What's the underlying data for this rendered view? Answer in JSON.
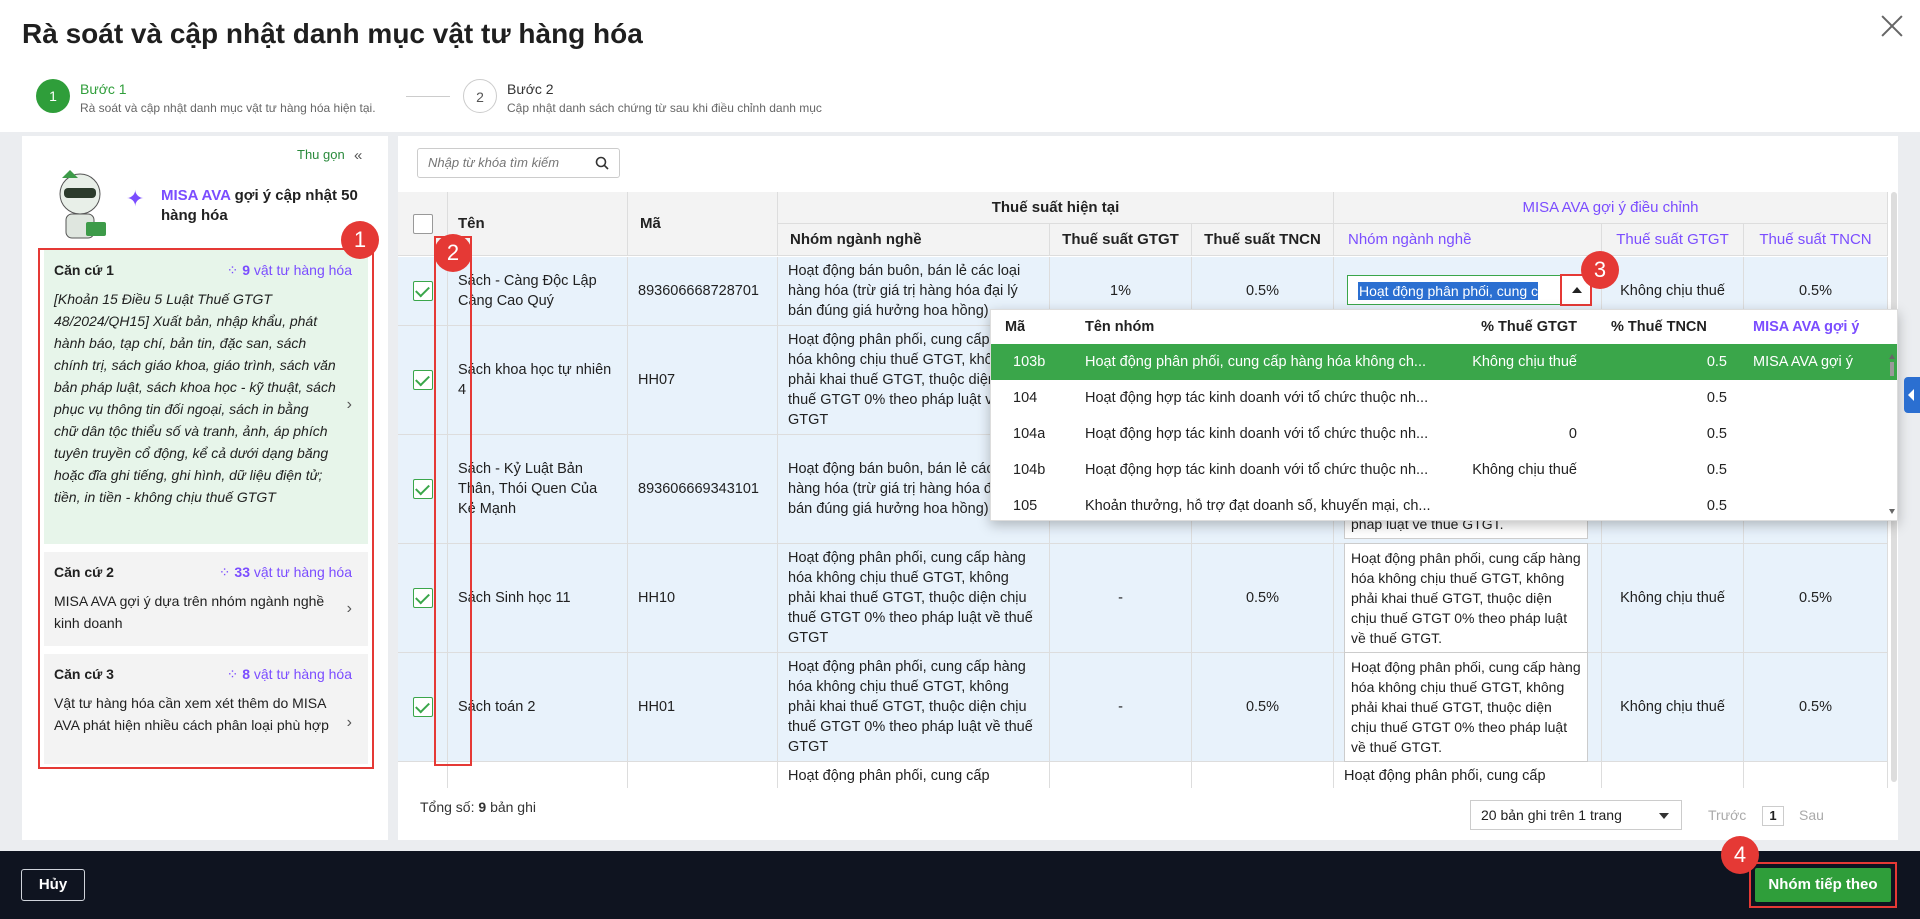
{
  "title": "Rà soát và cập nhật danh mục vật tư hàng hóa",
  "steps": [
    {
      "num": "1",
      "label": "Bước 1",
      "desc": "Rà soát và cập nhật danh mục vật tư hàng hóa hiện tại."
    },
    {
      "num": "2",
      "label": "Bước 2",
      "desc": "Cập nhật danh sách chứng từ sau khi điều chỉnh danh mục"
    }
  ],
  "sidebar": {
    "collapse_label": "Thu gọn",
    "ava_name": "MISA AVA",
    "ava_text": "gợi ý cập nhật 50 hàng hóa",
    "cards": [
      {
        "title": "Căn cứ 1",
        "count": "9",
        "count_suffix": "vật tư hàng hóa",
        "body": "[Khoản 15 Điều 5 Luật Thuế GTGT 48/2024/QH15] Xuất bản, nhập khẩu, phát hành báo, tạp chí, bản tin, đặc san, sách chính trị, sách giáo khoa, giáo trình, sách văn bản pháp luật, sách khoa học - kỹ thuật, sách phục vụ thông tin đối ngoại, sách in bằng chữ dân tộc thiểu số và tranh, ảnh, áp phích tuyên truyền cổ động, kể cả dưới dạng băng hoặc đĩa ghi tiếng, ghi hình, dữ liệu điện tử; tiền, in tiền - không chịu thuế GTGT"
      },
      {
        "title": "Căn cứ 2",
        "count": "33",
        "count_suffix": "vật tư hàng hóa",
        "body": "MISA AVA gợi ý dựa trên nhóm ngành nghề kinh doanh"
      },
      {
        "title": "Căn cứ 3",
        "count": "8",
        "count_suffix": "vật tư hàng hóa",
        "body": "Vật tư hàng hóa cần xem xét thêm do MISA AVA phát hiện nhiều cách phân loại phù hợp"
      }
    ]
  },
  "search": {
    "placeholder": "Nhập từ khóa tìm kiếm"
  },
  "table": {
    "headers": {
      "name": "Tên",
      "code": "Mã",
      "current_group": "Thuế suất hiện tại",
      "ava_group": "MISA AVA gợi ý điều chỉnh",
      "industry": "Nhóm ngành nghề",
      "vat": "Thuế suất GTGT",
      "pit": "Thuế suất TNCN"
    },
    "rows": [
      {
        "name": "Sách - Càng Độc Lập Càng Cao Quý",
        "code": "893606668728701",
        "industry": "Hoạt động bán buôn, bán lẻ các loại hàng hóa (trừ giá trị hàng hóa đại lý bán đúng giá hưởng hoa hồng)",
        "vat": "1%",
        "pit": "0.5%",
        "ava_industry": "Hoạt động phân phối, cung cấp hàng hóa không chịu thuế GTGT",
        "ava_vat": "Không chịu thuế",
        "ava_pit": "0.5%"
      },
      {
        "name": "Sách khoa học tự nhiên 4",
        "code": "HH07",
        "industry": "Hoạt động phân phối, cung cấp hàng hóa không chịu thuế GTGT, không phải khai thuế GTGT, thuộc diện chịu thuế GTGT 0% theo pháp luật về thuế GTGT",
        "vat": "",
        "pit": "",
        "ava_industry": "",
        "ava_vat": "",
        "ava_pit": ""
      },
      {
        "name": "Sách - Kỷ Luật Bản Thân, Thói Quen Của Kẻ Mạnh",
        "code": "893606669343101",
        "industry": "Hoạt động bán buôn, bán lẻ các loại hàng hóa (trừ giá trị hàng hóa đại lý bán đúng giá hưởng hoa hồng)",
        "vat": "",
        "pit": "",
        "ava_industry": "pháp luật về thuế GTGT.",
        "ava_vat": "",
        "ava_pit": ""
      },
      {
        "name": "Sách Sinh học 11",
        "code": "HH10",
        "industry": "Hoạt động phân phối, cung cấp hàng hóa không chịu thuế GTGT, không phải khai thuế GTGT, thuộc diện chịu thuế GTGT 0% theo pháp luật về thuế GTGT",
        "vat": "-",
        "pit": "0.5%",
        "ava_industry": "Hoạt động phân phối, cung cấp hàng hóa không chịu thuế GTGT, không phải khai thuế GTGT, thuộc diện chịu thuế GTGT 0% theo pháp luật về thuế GTGT.",
        "ava_vat": "Không chịu thuế",
        "ava_pit": "0.5%"
      },
      {
        "name": "Sách toán 2",
        "code": "HH01",
        "industry": "Hoạt động phân phối, cung cấp hàng hóa không chịu thuế GTGT, không phải khai thuế GTGT, thuộc diện chịu thuế GTGT 0% theo pháp luật về thuế GTGT",
        "vat": "-",
        "pit": "0.5%",
        "ava_industry": "Hoạt động phân phối, cung cấp hàng hóa không chịu thuế GTGT, không phải khai thuế GTGT, thuộc diện chịu thuế GTGT 0% theo pháp luật về thuế GTGT.",
        "ava_vat": "Không chịu thuế",
        "ava_pit": "0.5%"
      },
      {
        "name": "",
        "code": "",
        "industry": "Hoạt động phân phối, cung cấp",
        "vat": "",
        "pit": "",
        "ava_industry": "Hoạt động phân phối, cung cấp",
        "ava_vat": "",
        "ava_pit": ""
      }
    ]
  },
  "dropdown": {
    "value": "Hoạt động phân phối, cung cấp",
    "headers": {
      "code": "Mã",
      "name": "Tên nhóm",
      "vat": "% Thuế GTGT",
      "pit": "% Thuế TNCN",
      "ava": "MISA AVA gợi ý"
    },
    "options": [
      {
        "code": "103b",
        "name": "Hoạt động phân phối, cung cấp hàng hóa không ch...",
        "vat": "Không chịu thuế",
        "pit": "0.5",
        "ava": "MISA AVA gợi ý"
      },
      {
        "code": "104",
        "name": "Hoạt động hợp tác kinh doanh với tổ chức thuộc nh...",
        "vat": "",
        "pit": "0.5",
        "ava": ""
      },
      {
        "code": "104a",
        "name": "Hoạt động hợp tác kinh doanh với tổ chức thuộc nh...",
        "vat": "0",
        "pit": "0.5",
        "ava": ""
      },
      {
        "code": "104b",
        "name": "Hoạt động hợp tác kinh doanh với tổ chức thuộc nh...",
        "vat": "Không chịu thuế",
        "pit": "0.5",
        "ava": ""
      },
      {
        "code": "105",
        "name": "Khoản thưởng, hỗ trợ đạt doanh số, khuyến mại, ch...",
        "vat": "",
        "pit": "0.5",
        "ava": ""
      }
    ]
  },
  "pager": {
    "total_label": "Tổng số:",
    "total": "9",
    "total_suffix": "bản ghi",
    "per_page": "20 bản ghi trên 1 trang",
    "prev": "Trước",
    "page": "1",
    "next": "Sau"
  },
  "footer": {
    "cancel": "Hủy",
    "next": "Nhóm tiếp theo"
  },
  "badges": [
    "1",
    "2",
    "3",
    "4"
  ],
  "colors": {
    "accent": "#2f9e3a",
    "ava": "#7b4dff",
    "annotation": "#e53935",
    "selection": "#2b6fd1"
  }
}
